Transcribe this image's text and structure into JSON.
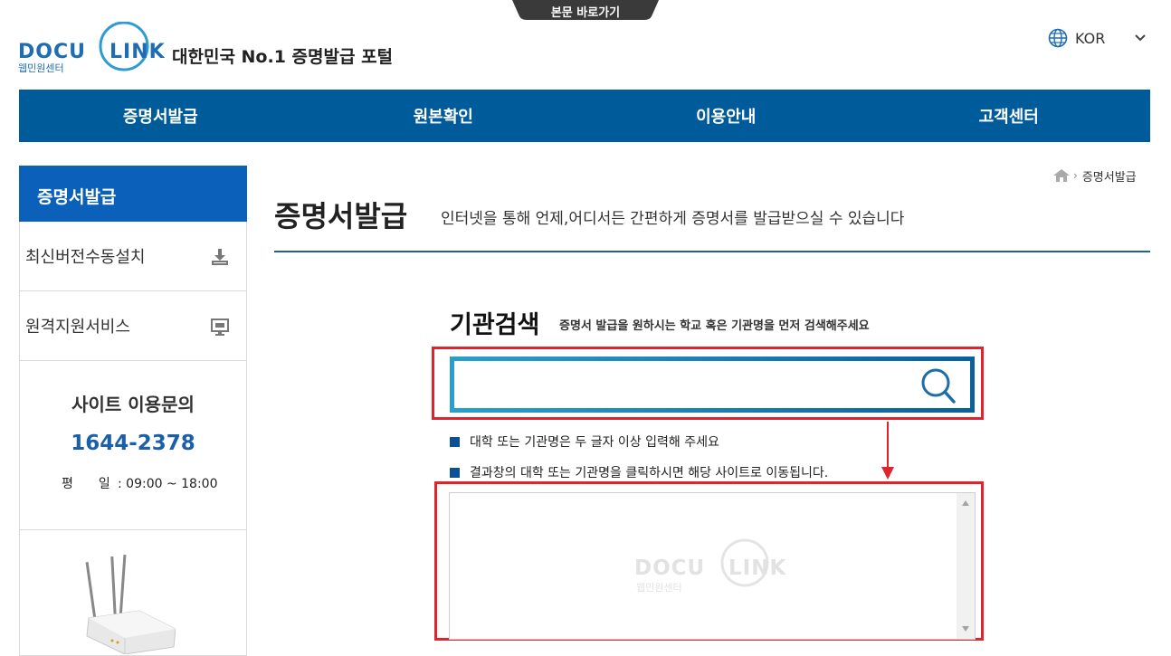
{
  "skip_link": "본문 바로가기",
  "brand": {
    "logo_text_left": "DOCU",
    "logo_text_right": "LINK",
    "logo_sub": "웹민원센터",
    "tagline": "대한민국 No.1 증명발급 포털"
  },
  "language": {
    "label": "KOR",
    "icon": "globe-icon"
  },
  "nav": [
    {
      "label": "증명서발급"
    },
    {
      "label": "원본확인"
    },
    {
      "label": "이용안내"
    },
    {
      "label": "고객센터"
    }
  ],
  "sidebar": {
    "title": "증명서발급",
    "menu": [
      {
        "label": "최신버전수동설치",
        "icon": "download-icon"
      },
      {
        "label": "원격지원서비스",
        "icon": "monitor-icon"
      }
    ],
    "contact": {
      "title": "사이트 이용문의",
      "phone": "1644-2378",
      "hours_label": "평　　일",
      "hours_value": ": 09:00 ~ 18:00"
    }
  },
  "breadcrumb": {
    "home_icon": "home-icon",
    "current": "증명서발급"
  },
  "page": {
    "title": "증명서발급",
    "description": "인터넷을 통해 언제,어디서든 간편하게 증명서를 발급받으실 수 있습니다"
  },
  "search": {
    "title": "기관검색",
    "subtitle": "증명서 발급을 원하시는 학교 혹은 기관명을 먼저 검색해주세요",
    "input_value": "",
    "placeholder": "",
    "notices": [
      "대학 또는 기관명은 두 글자 이상 입력해 주세요",
      "결과창의 대학 또는 기관명을 클릭하시면 해당 사이트로 이동됩니다."
    ]
  },
  "result": {
    "watermark_left": "DOCU",
    "watermark_right": "LINK",
    "watermark_sub": "웹민원센터"
  },
  "colors": {
    "nav_bg": "#005b9a",
    "sidebar_title_bg": "#0b60b9",
    "phone": "#1b5fa8",
    "highlight_red": "#e0242e",
    "search_border_start": "#2a9fcc",
    "search_border_end": "#0a5f9c"
  }
}
